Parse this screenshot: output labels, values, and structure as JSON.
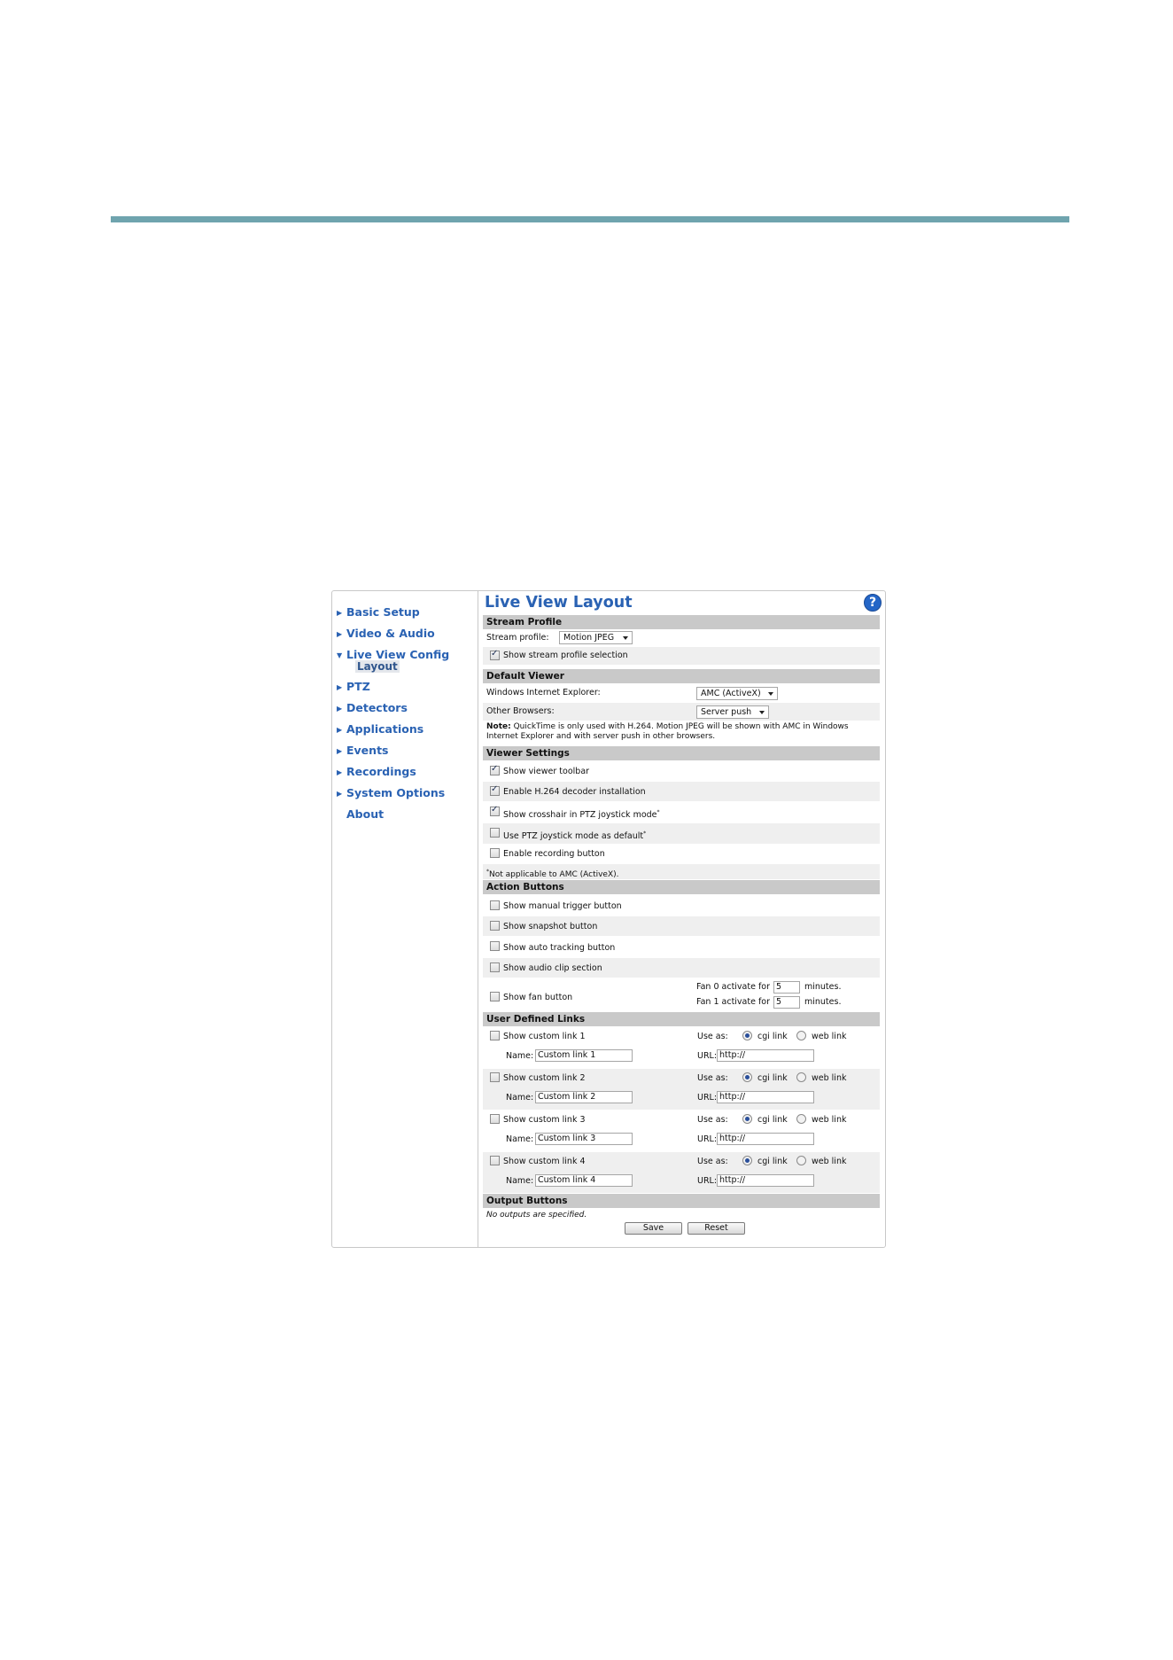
{
  "nav": {
    "items": [
      {
        "label": "Basic Setup",
        "expanded": false
      },
      {
        "label": "Video & Audio",
        "expanded": false
      },
      {
        "label": "Live View Config",
        "expanded": true
      },
      {
        "label": "PTZ",
        "expanded": false
      },
      {
        "label": "Detectors",
        "expanded": false
      },
      {
        "label": "Applications",
        "expanded": false
      },
      {
        "label": "Events",
        "expanded": false
      },
      {
        "label": "Recordings",
        "expanded": false
      },
      {
        "label": "System Options",
        "expanded": false
      },
      {
        "label": "About",
        "expanded": false
      }
    ],
    "sub_item": "Layout"
  },
  "page": {
    "title": "Live View Layout",
    "help_symbol": "?"
  },
  "stream_profile": {
    "header": "Stream Profile",
    "label": "Stream profile:",
    "value": "Motion JPEG",
    "show_selection": {
      "label": "Show stream profile selection",
      "checked": true
    }
  },
  "default_viewer": {
    "header": "Default Viewer",
    "ie_label": "Windows Internet Explorer:",
    "ie_value": "AMC (ActiveX)",
    "other_label": "Other Browsers:",
    "other_value": "Server push",
    "note_bold": "Note:",
    "note_line1": " QuickTime is only used with H.264. Motion JPEG will be shown with AMC in Windows",
    "note_line2": "Internet Explorer and with server push in other browsers."
  },
  "viewer_settings": {
    "header": "Viewer Settings",
    "toolbar": {
      "label": "Show viewer toolbar",
      "checked": true
    },
    "h264": {
      "label": "Enable H.264 decoder installation",
      "checked": true
    },
    "crosshair": {
      "label": "Show crosshair in PTZ joystick mode",
      "checked": true
    },
    "joystick_default": {
      "label": "Use PTZ joystick mode as default",
      "checked": false
    },
    "recording": {
      "label": "Enable recording button",
      "checked": false
    },
    "asterisk": "*",
    "footnote": "Not applicable to AMC (ActiveX)."
  },
  "action_buttons": {
    "header": "Action Buttons",
    "manual_trigger": {
      "label": "Show manual trigger button",
      "checked": false
    },
    "snapshot": {
      "label": "Show snapshot button",
      "checked": false
    },
    "auto_tracking": {
      "label": "Show auto tracking button",
      "checked": false
    },
    "audio_clip": {
      "label": "Show audio clip section",
      "checked": false
    },
    "fan": {
      "label": "Show fan button",
      "checked": false
    },
    "fan0_label": "Fan 0 activate for",
    "fan0_value": "5",
    "fan1_label": "Fan 1 activate for",
    "fan1_value": "5",
    "minutes": "minutes."
  },
  "user_links": {
    "header": "User Defined Links",
    "use_as": "Use as:",
    "cgi": "cgi link",
    "web": "web link",
    "name_label": "Name:",
    "url_label": "URL:",
    "links": [
      {
        "label": "Show custom link 1",
        "checked": false,
        "name": "Custom link 1",
        "url": "http://",
        "use": "cgi"
      },
      {
        "label": "Show custom link 2",
        "checked": false,
        "name": "Custom link 2",
        "url": "http://",
        "use": "cgi"
      },
      {
        "label": "Show custom link 3",
        "checked": false,
        "name": "Custom link 3",
        "url": "http://",
        "use": "cgi"
      },
      {
        "label": "Show custom link 4",
        "checked": false,
        "name": "Custom link 4",
        "url": "http://",
        "use": "cgi"
      }
    ]
  },
  "output_buttons": {
    "header": "Output Buttons",
    "note": "No outputs are specified."
  },
  "actions": {
    "save": "Save",
    "reset": "Reset"
  },
  "colors": {
    "accent_rule": "#6fa4ae",
    "link_blue": "#2a62b3",
    "section_gray": "#c9c9c9"
  }
}
